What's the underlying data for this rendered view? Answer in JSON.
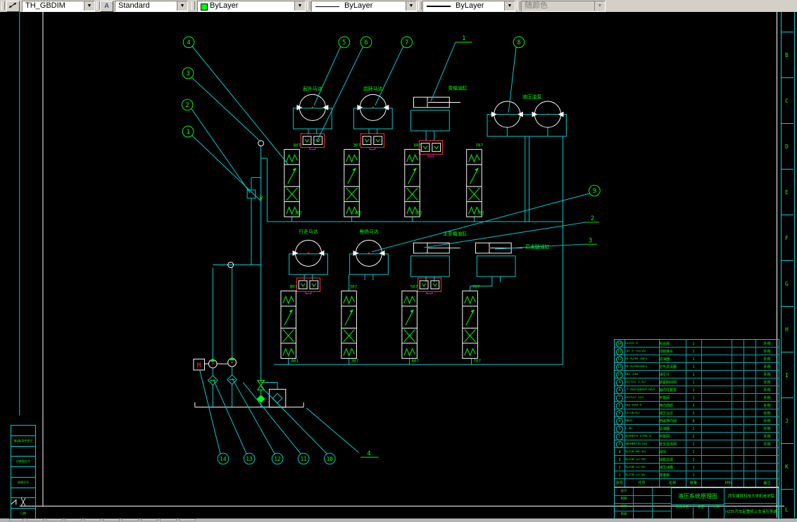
{
  "toolbar": {
    "dim_style": "TH_GBDIM",
    "text_style": "Standard",
    "color": "ByLayer",
    "linetype": "ByLayer",
    "lineweight": "ByLayer",
    "plot_style": "随颜色"
  },
  "colors": {
    "line_cyan": "#00cfcf",
    "text_green": "#00ff00",
    "symbol_white": "#ffffff",
    "alert_red": "#ff3030",
    "magenta": "#e800e8",
    "toolbar_bg": "#d4d0c8",
    "color_swatch": "#00ff00"
  },
  "component_labels": {
    "top": [
      "起升马达",
      "回转马达",
      "变幅油缸",
      "液压油泵"
    ],
    "bottom": [
      "行走马达",
      "卷扬马达",
      "主变幅油缸",
      "后支腿油缸"
    ],
    "pump_w": "W",
    "motor_m": "M"
  },
  "valve_tags": {
    "a_top": [
      "807",
      "307",
      "507",
      "707"
    ],
    "a_bot": [
      "307",
      "407",
      "507",
      "707"
    ],
    "b_top": [
      "807",
      "307",
      "507",
      "707"
    ],
    "b_bot": [
      "801",
      "307",
      "607",
      "707"
    ]
  },
  "callouts": {
    "c1": "1",
    "c2": "2",
    "c3": "3",
    "c4": "4",
    "c5": "5",
    "c6": "6",
    "c7": "7",
    "c8": "8",
    "c9": "9",
    "c10": "10",
    "c11": "11",
    "c12": "12",
    "c13": "13",
    "c14": "14",
    "p1": "1",
    "p2": "2",
    "p3": "3",
    "p4": "4"
  },
  "zone_letters": [
    "B",
    "C",
    "D",
    "E",
    "F",
    "G",
    "H",
    "I",
    "J",
    "K",
    "L"
  ],
  "left_strip": {
    "cells": [
      "",
      "借(通)用件登记",
      "",
      "旧底图总号",
      "",
      "底图总号",
      "",
      "╳",
      "日期"
    ]
  },
  "bom": {
    "headers": [
      "序号",
      "代号",
      "名称",
      "数量",
      "材料",
      "备注"
    ],
    "rows": [
      {
        "no": "14",
        "code": "YZ255-A",
        "name": "组合阀",
        "qty": "1",
        "remark": "外购"
      },
      {
        "no": "13",
        "code": "CSF-F-53/26",
        "name": "回转接头",
        "qty": "1",
        "remark": "外购"
      },
      {
        "no": "12",
        "code": "XU-A250 50FS",
        "name": "滤油器",
        "qty": "1",
        "remark": "外购"
      },
      {
        "no": "11",
        "code": "XU-A250x50FS",
        "name": "空气滤清器",
        "qty": "1",
        "remark": "外购"
      },
      {
        "no": "10",
        "code": "YWZ-250",
        "name": "油位计",
        "qty": "1",
        "remark": "外购"
      },
      {
        "no": "9",
        "code": "32LYZ1-1.63",
        "name": "锁紧制动阀",
        "qty": "1",
        "remark": "外购"
      },
      {
        "no": "8",
        "code": "CY-A4V56DR9Y70SY",
        "name": "轴向柱塞泵",
        "qty": "2",
        "remark": "外购"
      },
      {
        "no": "7",
        "code": "32LYZ2-125",
        "name": "平衡阀",
        "qty": "1",
        "remark": "外购"
      },
      {
        "no": "6",
        "code": "SHZ-H20-X",
        "name": "换向阀组",
        "qty": "5",
        "remark": "外购"
      },
      {
        "no": "5",
        "code": "A2F56/61",
        "name": "液压马达",
        "qty": "3",
        "remark": "外购"
      },
      {
        "no": "4",
        "code": "4WE6",
        "name": "电磁换向阀",
        "qty": "8",
        "remark": "外购"
      },
      {
        "no": "3",
        "code": "7-46",
        "name": "滤油器",
        "qty": "2",
        "remark": "外购"
      },
      {
        "no": "2",
        "code": "REXROTH 57R4.6",
        "name": "平衡阀",
        "qty": "2",
        "remark": "外购"
      },
      {
        "no": "1",
        "code": "DBDH6K10/102",
        "name": "安全溢流阀",
        "qty": "1",
        "remark": "外购"
      },
      {
        "no": "4",
        "code": "MZ250-04-03",
        "name": "阀块",
        "qty": "1",
        "remark": ""
      },
      {
        "no": "3",
        "code": "MZ250-12-04",
        "name": "油管总成",
        "qty": "1",
        "remark": ""
      },
      {
        "no": "2",
        "code": "MZ250-12-05",
        "name": "液压油箱",
        "qty": "1",
        "remark": ""
      },
      {
        "no": "1",
        "code": "MZ250-12-02",
        "name": "连接板",
        "qty": "1",
        "remark": ""
      }
    ]
  },
  "title_block": {
    "title": "液压系统原理图",
    "org": "西安建筑科技大学机电学院",
    "project": "HZ25汽车起重机上车液压系统",
    "sig_rows": [
      "设计",
      "制图",
      "校核",
      "审核"
    ],
    "stage": "阶段标记",
    "mass": "质量",
    "scale": "比例"
  }
}
